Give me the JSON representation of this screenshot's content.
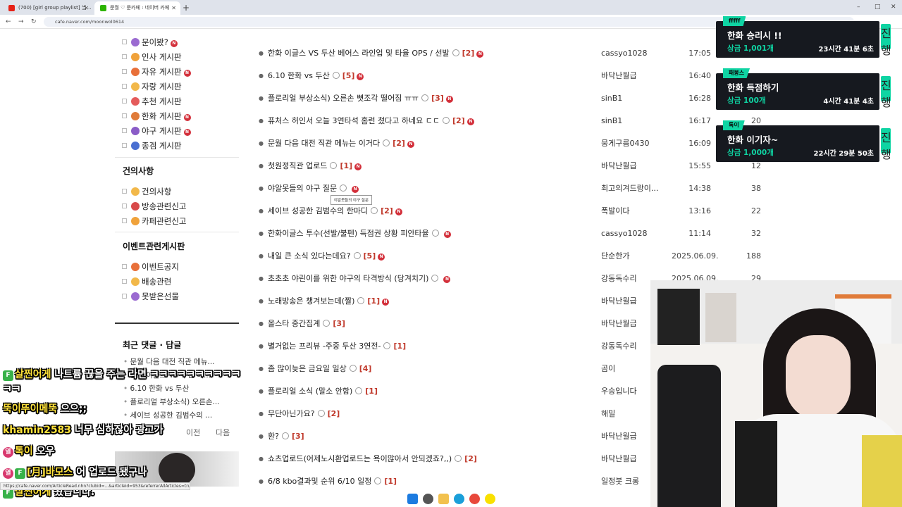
{
  "browser": {
    "tabs": [
      {
        "title": "(700) [girl group playlist] 当..."
      },
      {
        "title": "문월 ♡ 문카페 : 네이버 카페"
      }
    ],
    "new_tab": "+",
    "url": "cafe.naver.com/moonwol0614"
  },
  "sidebar": {
    "menu_top": [
      {
        "label": "문이봤?",
        "new": true,
        "color": "#9b6bd1"
      },
      {
        "label": "인사 게시판",
        "new": false,
        "color": "#f0a23b"
      },
      {
        "label": "자유 게시판",
        "new": true,
        "color": "#e8703a"
      },
      {
        "label": "자랑 게시판",
        "new": false,
        "color": "#f2b84a"
      },
      {
        "label": "추천 게시판",
        "new": false,
        "color": "#e45b5b"
      },
      {
        "label": "한화 게시판",
        "new": true,
        "color": "#e07b39"
      },
      {
        "label": "야구 게시판",
        "new": true,
        "color": "#8a5cc7"
      },
      {
        "label": "종겜 게시판",
        "new": false,
        "color": "#4a6fd1"
      }
    ],
    "section_suggest": "건의사항",
    "menu_suggest": [
      {
        "label": "건의사항",
        "color": "#f2b84a"
      },
      {
        "label": "방송관련신고",
        "color": "#d84a4a"
      },
      {
        "label": "카페관련신고",
        "color": "#f0a23b"
      }
    ],
    "section_event": "이벤트관련게시판",
    "menu_event": [
      {
        "label": "이벤트공지",
        "color": "#e8703a"
      },
      {
        "label": "배송관련",
        "color": "#f2b84a"
      },
      {
        "label": "못받은선물",
        "color": "#9b6bd1"
      }
    ],
    "recent_title": "최근 댓글 · 답글",
    "recent": [
      "문월 다음 대전 직관 메뉴...",
      "한화 이글스 VS 두산 베...",
      "6.10 한화 vs 두산",
      "플로리얼 부상소식) 오른손...",
      "세이브 성공한 김범수의 ..."
    ],
    "prev": "이전",
    "next": "다음"
  },
  "articles": [
    {
      "title": "한화 이글스 VS 두산 베어스 라인업 및 타율 OPS / 선발",
      "comments": "[2]",
      "new": true,
      "author": "cassyo1028",
      "date": "17:05",
      "views": ""
    },
    {
      "title": "6.10 한화 vs 두산",
      "comments": "[5]",
      "new": true,
      "author": "바닥난월급",
      "date": "16:40",
      "views": ""
    },
    {
      "title": "플로리얼 부상소식) 오른손 뼛조각 떨어짐 ㅠㅠ",
      "comments": "[3]",
      "new": true,
      "author": "sinB1",
      "date": "16:28",
      "views": ""
    },
    {
      "title": "퓨처스 허인서 오늘 3연타석 홈런 쳤다고 하네요 ㄷㄷ",
      "comments": "[2]",
      "new": true,
      "author": "sinB1",
      "date": "16:17",
      "views": "20"
    },
    {
      "title": "문월 다음 대전 직관 메뉴는 이거다",
      "comments": "[2]",
      "new": true,
      "author": "뭉게구름0430",
      "date": "16:09",
      "views": ""
    },
    {
      "title": "첫원정직관 업로드",
      "comments": "[1]",
      "new": true,
      "author": "바닥난월급",
      "date": "15:55",
      "views": "12"
    },
    {
      "title": "야알못들의 야구 질문",
      "comments": "",
      "new": true,
      "author": "최고의겨드랑이...",
      "date": "14:38",
      "views": "38"
    },
    {
      "title": "세이브 성공한 김범수의 한마디",
      "comments": "[2]",
      "new": true,
      "author": "폭발이다",
      "date": "13:16",
      "views": "22"
    },
    {
      "title": "한화이글스 투수(선발/불펜) 득점권 상황 피안타율",
      "comments": "",
      "new": true,
      "author": "cassyo1028",
      "date": "11:14",
      "views": "32"
    },
    {
      "title": "내일 큰 소식 있다는데요?",
      "comments": "[5]",
      "new": true,
      "author": "단순한가",
      "date": "2025.06.09.",
      "views": "188"
    },
    {
      "title": "초초초 야린이를 위한 야구의 타격방식 (당겨치기)",
      "comments": "",
      "new": true,
      "author": "강동독수리",
      "date": "2025.06.09.",
      "views": "29"
    },
    {
      "title": "노래방송은 챙겨보는데(짤)",
      "comments": "[1]",
      "new": true,
      "author": "바닥난월급",
      "date": "",
      "views": ""
    },
    {
      "title": "올스타 중간집계",
      "comments": "[3]",
      "new": false,
      "author": "바닥난월급",
      "date": "",
      "views": ""
    },
    {
      "title": "별거없는 프리뷰 -주중 두산 3연전-",
      "comments": "[1]",
      "new": false,
      "author": "강동독수리",
      "date": "",
      "views": ""
    },
    {
      "title": "좀 많이늦은 금요일 일상",
      "comments": "[4]",
      "new": false,
      "author": "곰이",
      "date": "",
      "views": ""
    },
    {
      "title": "플로리얼 소식 (말소 안함)",
      "comments": "[1]",
      "new": false,
      "author": "우승입니다",
      "date": "",
      "views": ""
    },
    {
      "title": "무단아닌가요?",
      "comments": "[2]",
      "new": false,
      "author": "해밀",
      "date": "",
      "views": ""
    },
    {
      "title": "환?",
      "comments": "[3]",
      "new": false,
      "author": "바닥난월급",
      "date": "",
      "views": ""
    },
    {
      "title": "쇼츠업로드(어제노시환업로드는 욕이많아서 안되겠죠?,,)",
      "comments": "[2]",
      "new": false,
      "author": "바닥난월급",
      "date": "",
      "views": ""
    },
    {
      "title": "6/8 kbo결과및 순위 6/10 일정",
      "comments": "[1]",
      "new": false,
      "author": "일정봇 크롱",
      "date": "",
      "views": ""
    }
  ],
  "tooltip": "야알못들의 야구 질문",
  "missions": [
    {
      "tag": "fffff",
      "title": "한화 승리시 !!",
      "prize": "상금 1,001개",
      "time": "23시간 41분  6초",
      "side": "진행"
    },
    {
      "tag": "패봉스",
      "title": "한화 득점하기",
      "prize": "상금 100개",
      "time": "4시간 41분  4초",
      "side": "진행"
    },
    {
      "tag": "톡이",
      "title": "한화 이기자~",
      "prize": "상금 1,000개",
      "time": "22시간 29분 50초",
      "side": "진행"
    }
  ],
  "chat": [
    {
      "badges": [
        "f"
      ],
      "nick": "살찐어게",
      "msg": " 나트륨 끊을 주는 라면 ㅋㅋㅋㅋㅋㅋㅋㅋㅋㅋ"
    },
    {
      "badges": [],
      "nick": "",
      "msg": "ㅋㅋ"
    },
    {
      "badges": [],
      "nick": "뚝이뚜이메뚝",
      "msg": " 으으;;"
    },
    {
      "badges": [],
      "nick": "khamin2583",
      "msg": " 너무 심하잖아 광고가"
    },
    {
      "badges": [
        "p"
      ],
      "nick": "톡이",
      "msg": " 오우"
    },
    {
      "badges": [
        "p",
        "f"
      ],
      "nick": "[月]바모스",
      "msg": " 어 업로드 됐구나"
    },
    {
      "badges": [
        "f"
      ],
      "nick": "살찐어게",
      "msg": " 왔습니다."
    }
  ],
  "status_url": "https://cafe.naver.com/ArticleRead.nhn?clubid=...&articleid=953&referrerAllArticles=true",
  "colors": {
    "accent_new": "#d32f3a",
    "comment": "#c0392b",
    "mission_green": "#0fd4a3",
    "chat_nick": "#ffe23a"
  }
}
